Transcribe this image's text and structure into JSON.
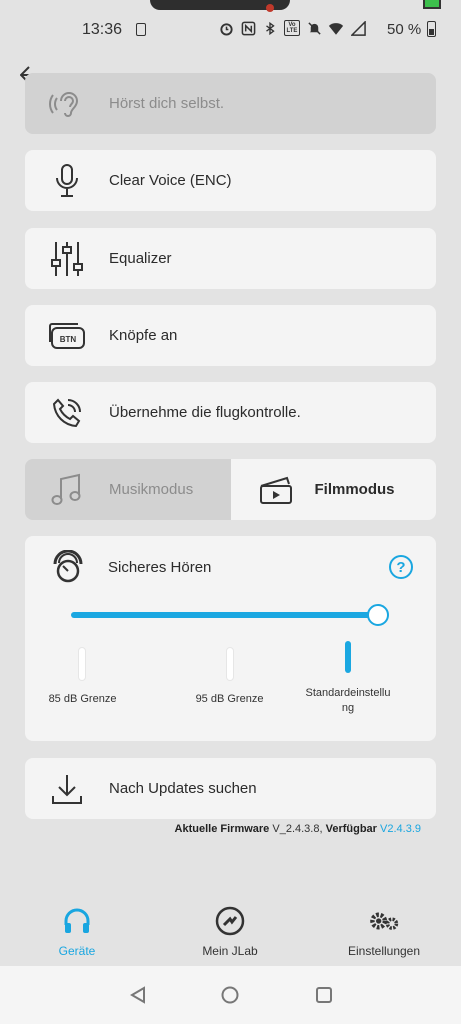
{
  "status_bar": {
    "time": "13:36",
    "battery_percent": "50 %",
    "icons": [
      "alarm-icon",
      "nfc-icon",
      "bluetooth-icon",
      "volte-icon",
      "mute-icon",
      "wifi-icon",
      "signal-icon",
      "battery-icon"
    ],
    "volte_text": "Vo LTE"
  },
  "items": {
    "hear_yourself": "Hörst dich selbst.",
    "clear_voice": "Clear Voice (ENC)",
    "equalizer": "Equalizer",
    "buttons": "Knöpfe an",
    "buttons_icon_text": "BTN",
    "flight": "Übernehme die flugkontrolle."
  },
  "mode": {
    "music": "Musikmodus",
    "film": "Filmmodus",
    "selected": "Filmmodus"
  },
  "safe_hearing": {
    "title": "Sicheres Hören",
    "help": "?",
    "slider_level": 1.0,
    "levels": [
      "85 dB Grenze",
      "95 dB Grenze",
      "Standardeinstellu\nng"
    ],
    "selected_level": 2
  },
  "updates": {
    "label": "Nach Updates suchen"
  },
  "firmware": {
    "current_label": "Aktuelle Firmware",
    "current_version": "V_2.4.3.8",
    "available_label": "Verfügbar",
    "available_version": "V2.4.3.9"
  },
  "bottom_nav": {
    "devices": "Geräte",
    "mylab": "Mein JLab",
    "settings": "Einstellungen",
    "active": "Geräte"
  },
  "colors": {
    "accent": "#1aa7e1",
    "background": "#e3e3e3",
    "card": "#f4f4f4",
    "card_disabled": "#d2d2d2"
  }
}
